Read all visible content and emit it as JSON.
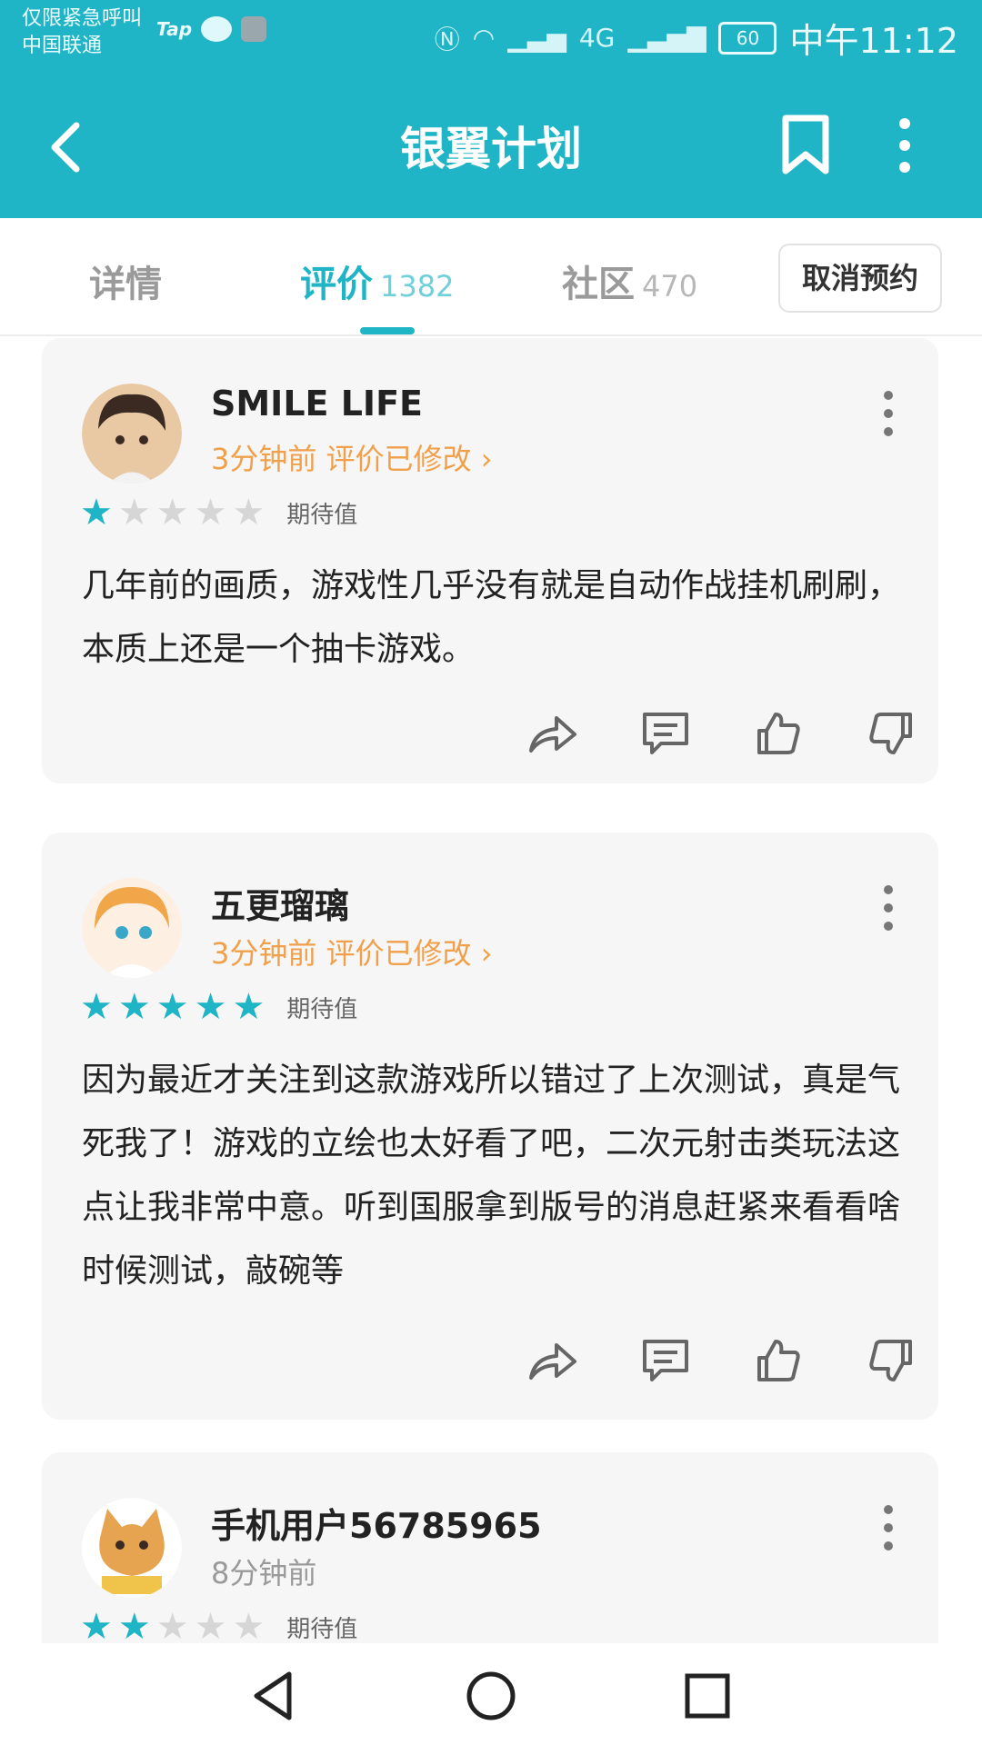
{
  "status_bar": {
    "carrier_line1": "仅限紧急呼叫",
    "carrier_line2": "中国联通",
    "tap_label": "Tap",
    "network_small": "4G",
    "battery": "60",
    "time": "中午11:12"
  },
  "app_bar": {
    "title": "银翼计划"
  },
  "tabs": [
    {
      "label": "详情",
      "count": ""
    },
    {
      "label": "评价",
      "count": "1382"
    },
    {
      "label": "社区",
      "count": "470"
    }
  ],
  "cancel_button": "取消预约",
  "reviews": [
    {
      "user": "SMILE LIFE",
      "meta": "3分钟前 评价已修改 ›",
      "rating": 1,
      "rating_label": "期待值",
      "text": "几年前的画质，游戏性几乎没有就是自动作战挂机刷刷，本质上还是一个抽卡游戏。"
    },
    {
      "user": "五更瑠璃",
      "meta": "3分钟前 评价已修改 ›",
      "rating": 5,
      "rating_label": "期待值",
      "text": "因为最近才关注到这款游戏所以错过了上次测试，真是气死我了！游戏的立绘也太好看了吧，二次元射击类玩法这点让我非常中意。听到国服拿到版号的消息赶紧来看看啥时候测试，敲碗等"
    },
    {
      "user": "手机用户56785965",
      "meta": "8分钟前",
      "rating": 2,
      "rating_label": "期待值",
      "text": ""
    }
  ],
  "colors": {
    "accent": "#1fb5c6",
    "meta_orange": "#f0a04b",
    "star_off": "#d6d6d6"
  },
  "icons": {
    "back": "chevron-left-icon",
    "bookmark": "bookmark-icon",
    "menu": "more-vertical-icon",
    "share": "share-icon",
    "comment": "comment-icon",
    "like": "thumbs-up-icon",
    "dislike": "thumbs-down-icon"
  }
}
